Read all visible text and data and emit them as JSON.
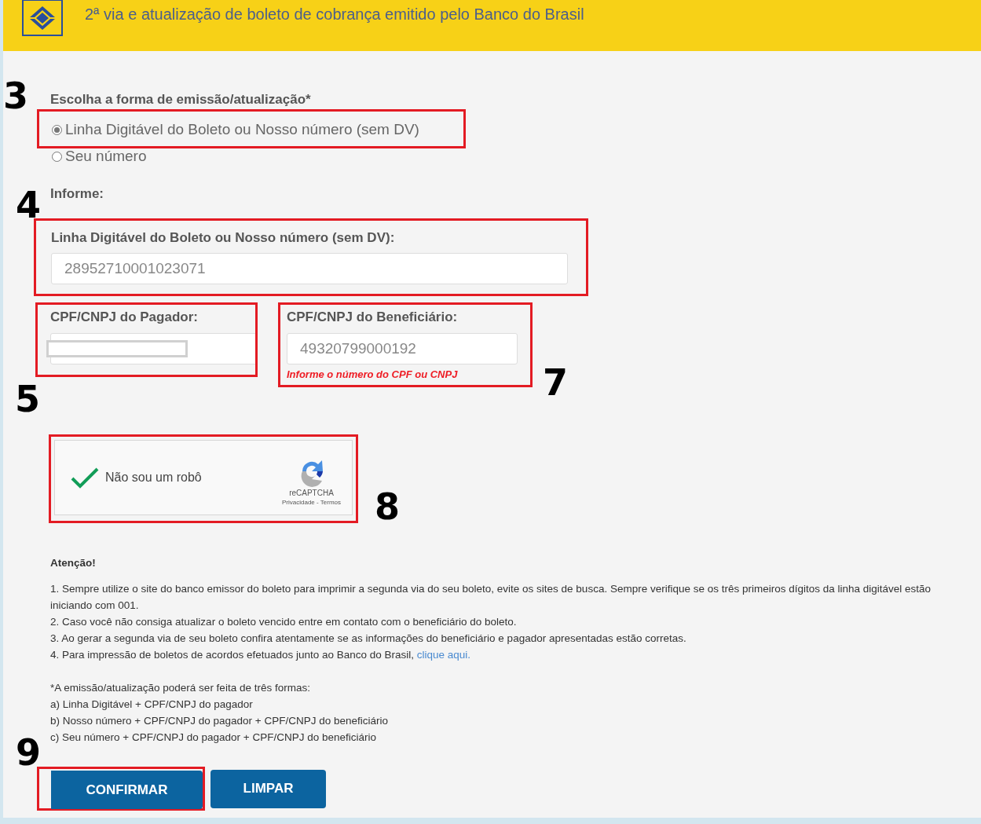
{
  "header": {
    "title": "2ª via e atualização de boleto de cobrança emitido pelo Banco do Brasil"
  },
  "emission": {
    "label": "Escolha a forma de emissão/atualização*",
    "annotation": "3",
    "options": [
      {
        "label": "Linha Digitável do Boleto ou Nosso número (sem DV)",
        "selected": true,
        "highlighted": true
      },
      {
        "label": "Seu número",
        "selected": false,
        "highlighted": false
      }
    ]
  },
  "inform_label": "Informe:",
  "line_field": {
    "label": "Linha Digitável do Boleto ou Nosso número (sem DV):",
    "value": "28952710001023071",
    "highlighted": true,
    "annotation": "4"
  },
  "payer_field": {
    "label": "CPF/CNPJ do Pagador:",
    "redacted": true,
    "highlighted": true,
    "annotation": "5"
  },
  "beneficiary_field": {
    "label": "CPF/CNPJ do Beneficiário:",
    "value": "49320799000192",
    "error": "Informe o número do CPF ou CNPJ",
    "highlighted": true,
    "annotation": "7"
  },
  "captcha": {
    "checked": true,
    "label": "Não sou um robô",
    "brand": "reCAPTCHA",
    "links": "Privacidade - Termos",
    "highlighted": true,
    "annotation": "8"
  },
  "notes": {
    "title": "Atenção!",
    "items": [
      {
        "text": "1. Sempre utilize o site do banco emissor do boleto para imprimir a segunda via do seu boleto, evite os sites de busca. Sempre verifique se os três primeiros dígitos da linha digitável estão iniciando com 001."
      },
      {
        "text": "2. Caso você não consiga atualizar o boleto vencido entre em contato com o beneficiário do boleto."
      },
      {
        "text": "3. Ao gerar a segunda via de seu boleto confira atentamente se as informações do beneficiário e pagador apresentadas estão corretas."
      },
      {
        "text": "4. Para impressão de boletos de acordos efetuados junto ao Banco do Brasil,",
        "link": "clique aqui."
      }
    ],
    "footnote": [
      "*A emissão/atualização poderá ser feita de três formas:",
      "a) Linha Digitável + CPF/CNPJ do pagador",
      "b) Nosso número + CPF/CNPJ do pagador + CPF/CNPJ do beneficiário",
      "c) Seu número + CPF/CNPJ do pagador + CPF/CNPJ do beneficiário"
    ]
  },
  "buttons": [
    {
      "label": "CONFIRMAR",
      "highlighted": true,
      "annotation": "9"
    },
    {
      "label": "LIMPAR",
      "highlighted": false
    }
  ]
}
